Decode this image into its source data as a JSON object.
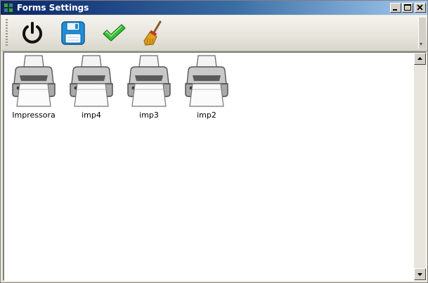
{
  "window": {
    "title": "Forms Settings",
    "icons": [
      "app-icon",
      "minimize-icon",
      "maximize-icon",
      "close-icon"
    ]
  },
  "toolbar": {
    "tools": [
      {
        "name": "power-button",
        "icon": "power-icon"
      },
      {
        "name": "save-button",
        "icon": "floppy-disk-icon"
      },
      {
        "name": "confirm-button",
        "icon": "checkmark-icon"
      },
      {
        "name": "clear-button",
        "icon": "broom-icon"
      }
    ]
  },
  "printers": [
    {
      "label": "Impressora",
      "icon": "printer-icon"
    },
    {
      "label": "imp4",
      "icon": "printer-icon"
    },
    {
      "label": "imp3",
      "icon": "printer-icon"
    },
    {
      "label": "imp2",
      "icon": "printer-icon"
    }
  ],
  "colors": {
    "titlebar_start": "#0a246a",
    "titlebar_end": "#a6caf0",
    "save_blue": "#1f8fd8",
    "check_green": "#3cbf3c",
    "broom_gold": "#e0a020"
  }
}
